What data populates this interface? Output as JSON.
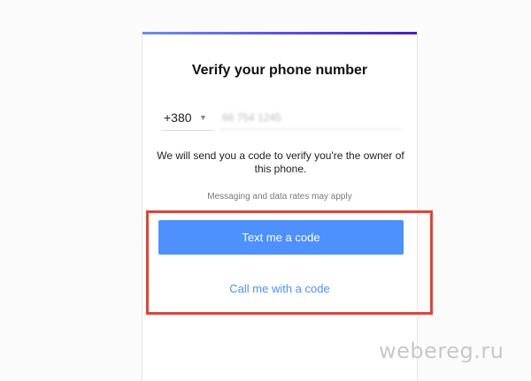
{
  "page": {
    "title": "Verify your phone number"
  },
  "phone": {
    "country_code": "+380",
    "number_value": "66 754 1245"
  },
  "info": {
    "message": "We will send you a code to verify you're the owner of this phone.",
    "rates_notice": "Messaging and data rates may apply"
  },
  "actions": {
    "text_label": "Text me a code",
    "call_label": "Call me with a code"
  },
  "watermark": {
    "text": "webereg.ru"
  },
  "colors": {
    "accent": "#4d90fe",
    "highlight": "#d9473a"
  }
}
